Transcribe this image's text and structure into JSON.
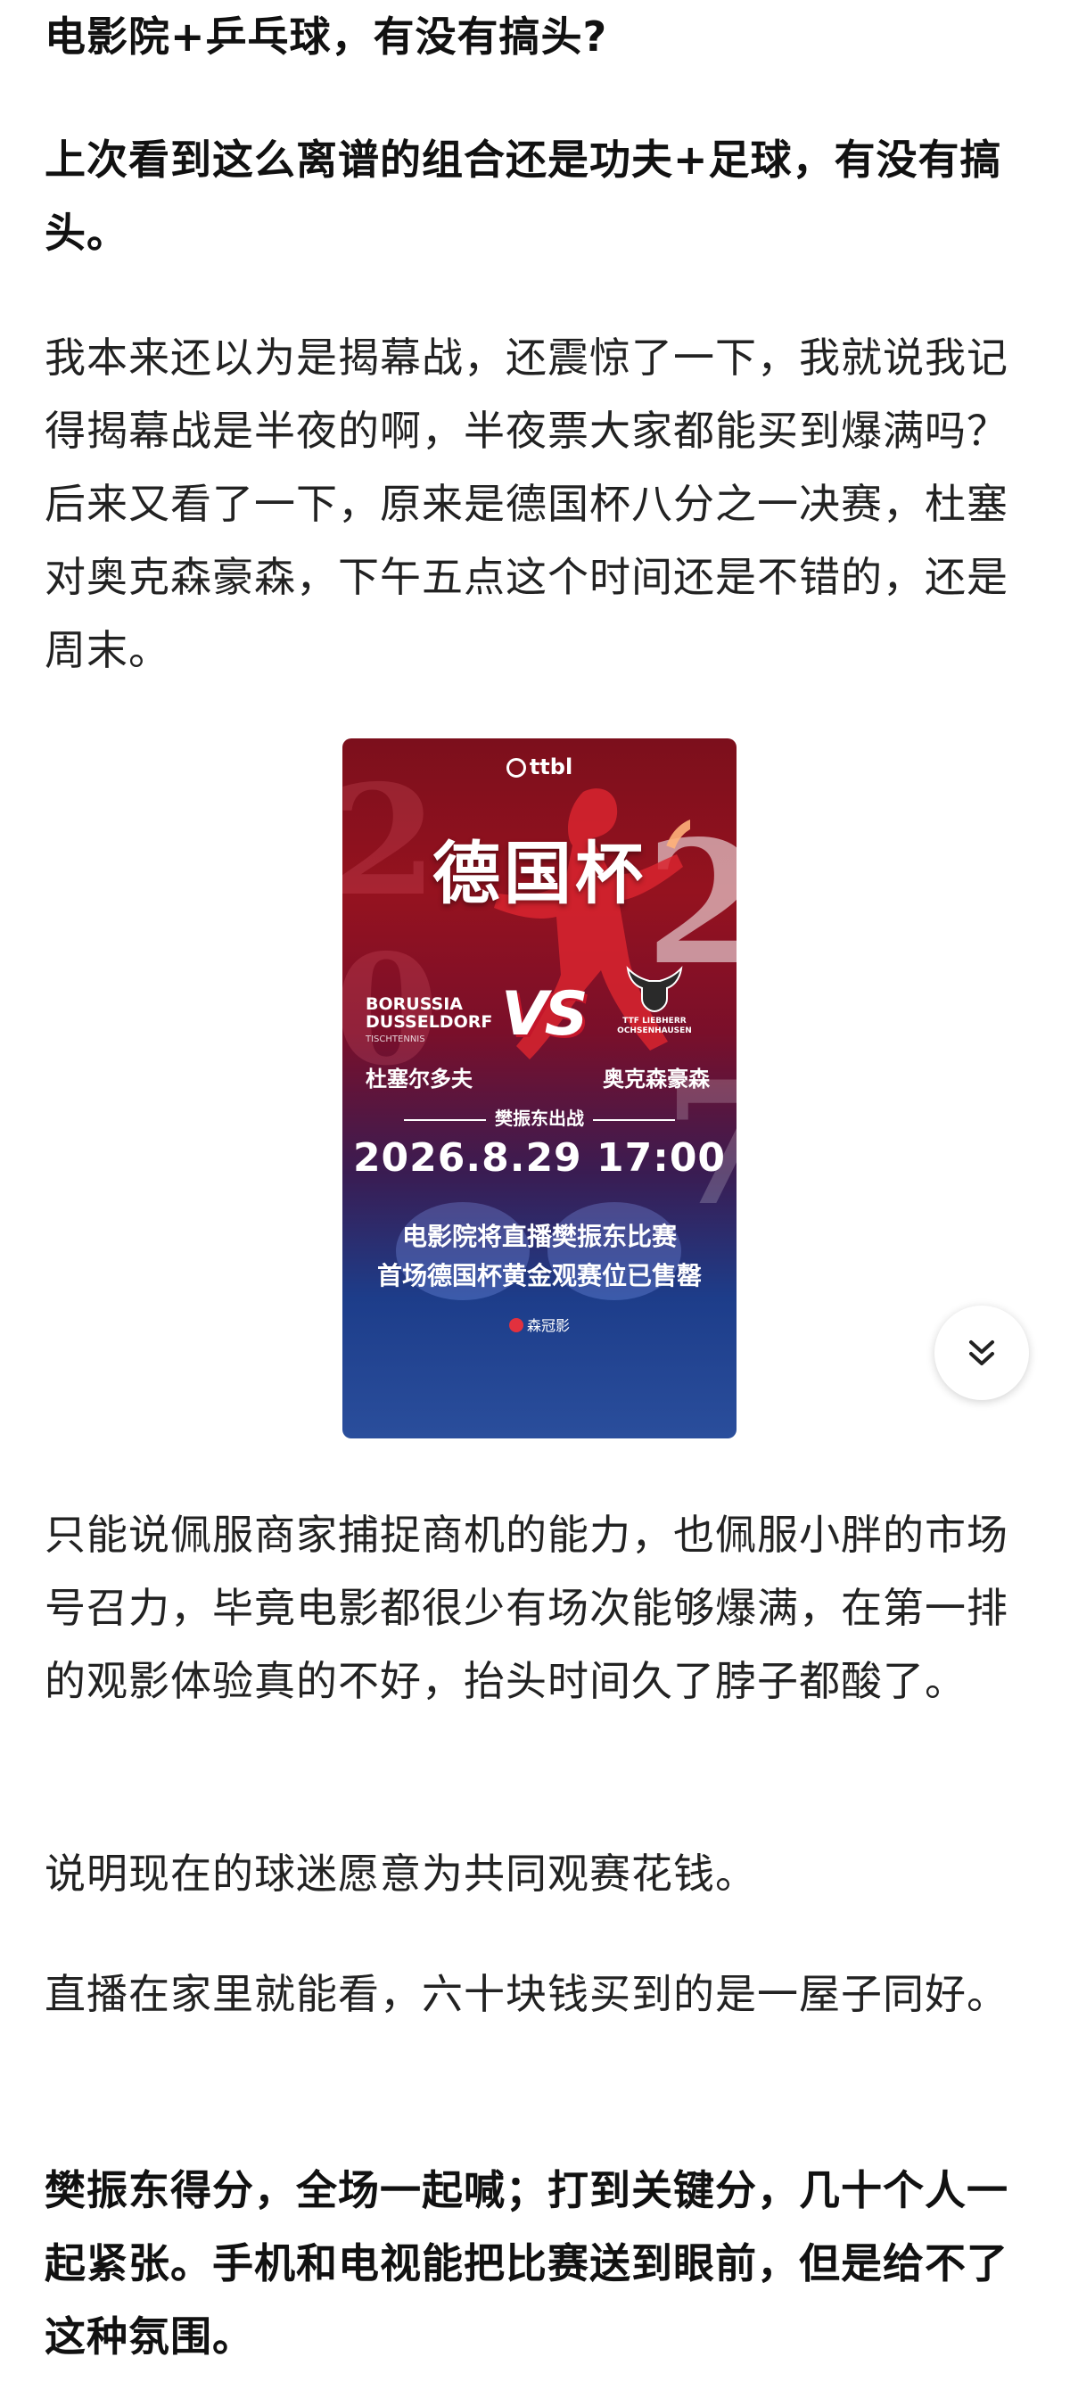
{
  "article": {
    "title_line": "电影院+乒乓球，有没有搞头?",
    "lead_bold": "上次看到这么离谱的组合还是功夫+足球，有没有搞头。",
    "para_intro": "我本来还以为是揭幕战，还震惊了一下，我就说我记得揭幕战是半夜的啊，半夜票大家都能买到爆满吗？后来又看了一下，原来是德国杯八分之一决赛，杜塞对奥克森豪森，下午五点这个时间还是不错的，还是周末。",
    "para_admire": "只能说佩服商家捕捉商机的能力，也佩服小胖的市场号召力，毕竟电影都很少有场次能够爆满，在第一排的观影体验真的不好，抬头时间久了脖子都酸了。",
    "para_fans": "说明现在的球迷愿意为共同观赛花钱。",
    "para_home": "直播在家里就能看，六十块钱买到的是一屋子同好。",
    "para_closing_bold": "樊振东得分，全场一起喊；打到关键分，几十个人一起紧张。手机和电视能把比赛送到眼前，但是给不了这种氛围。"
  },
  "poster": {
    "league_logo": "ttbl",
    "title": "德国杯",
    "team_left_logo": "BORUSSIA DUSSELDORF",
    "team_left_logo_sub": "TISCHTENNIS",
    "team_left_name": "杜塞尔多夫",
    "team_right_logo": "TTF LIEBHERR OCHSENHAUSEN",
    "team_right_name": "奥克森豪森",
    "vs": "VS",
    "match_label": "樊振东出战",
    "datetime": "2026.8.29   17:00",
    "line1": "电影院将直播樊振东比赛",
    "line2": "首场德国杯黄金观赛位已售罄",
    "footer": "森冠影",
    "bg_year": [
      "2",
      "0",
      "2",
      "7"
    ],
    "colors": {
      "top": "#95121f",
      "bottom": "#2a4e9c",
      "accent": "#c4162a"
    }
  },
  "ui": {
    "expand_icon": "double-chevron-down-icon"
  }
}
